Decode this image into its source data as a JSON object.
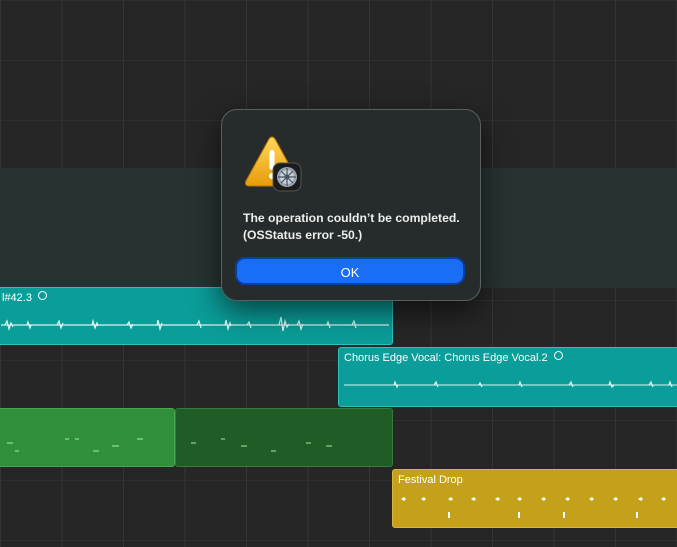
{
  "dialog": {
    "message": "The operation couldn’t be completed. (OSStatus error -50.)",
    "ok_label": "OK",
    "icons": [
      "warning-triangle-icon",
      "logic-app-icon"
    ],
    "colors": {
      "button": "#1a6ef5",
      "background": "#262c2c"
    }
  },
  "regions": {
    "audio_1": {
      "label": "l#42.3"
    },
    "audio_2": {
      "label": "Chorus Edge Vocal: Chorus Edge Vocal.2"
    },
    "midi_yellow": {
      "label": "Festival Drop"
    }
  },
  "colors": {
    "audio": "#0b9d99",
    "midi_green": "#2f8f3a",
    "midi_dark": "#1f5c26",
    "midi_yellow": "#c5a01a"
  }
}
